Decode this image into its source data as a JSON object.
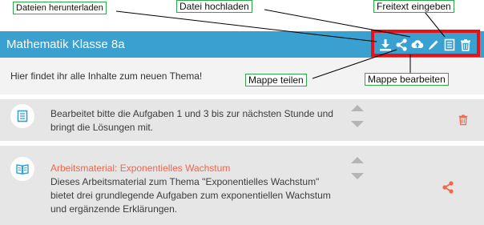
{
  "header": {
    "title": "Mathematik Klasse 8a",
    "background": "#3aa0d0"
  },
  "toolbar": {
    "icons": [
      "download-icon",
      "share-icon",
      "cloud-upload-icon",
      "pencil-icon",
      "text-document-icon",
      "trash-icon"
    ]
  },
  "intro": {
    "text": "Hier findet ihr alle Inhalte zum neuen Thema!"
  },
  "items": [
    {
      "icon": "text-document-icon",
      "line1": "Bearbeitet bitte die Aufgaben 1 und 3 bis zur nächsten Stunde und",
      "line2": "bringt die Lösungen mit.",
      "action_icon": "trash-icon"
    },
    {
      "icon": "book-icon",
      "title": "Arbeitsmaterial: Exponentielles Wachstum",
      "line1": "Dieses Arbeitsmaterial zum Thema \"Exponentielles Wachstum\"",
      "line2": "bietet drei grundlegende Aufgaben zum exponentiellen Wachstum",
      "line3": "und ergänzende Erklärungen.",
      "action_icon": "share-icon"
    }
  ],
  "callouts": {
    "download": "Dateien herunterladen",
    "upload": "Datei hochladen",
    "freetext": "Freitext eingeben",
    "share": "Mappe teilen",
    "edit": "Mappe bearbeiten"
  },
  "colors": {
    "accent": "#f2664a",
    "highlight_border": "#e5121a",
    "callout_border": "#2ca84a",
    "row_bg": "#e6e6e6"
  }
}
